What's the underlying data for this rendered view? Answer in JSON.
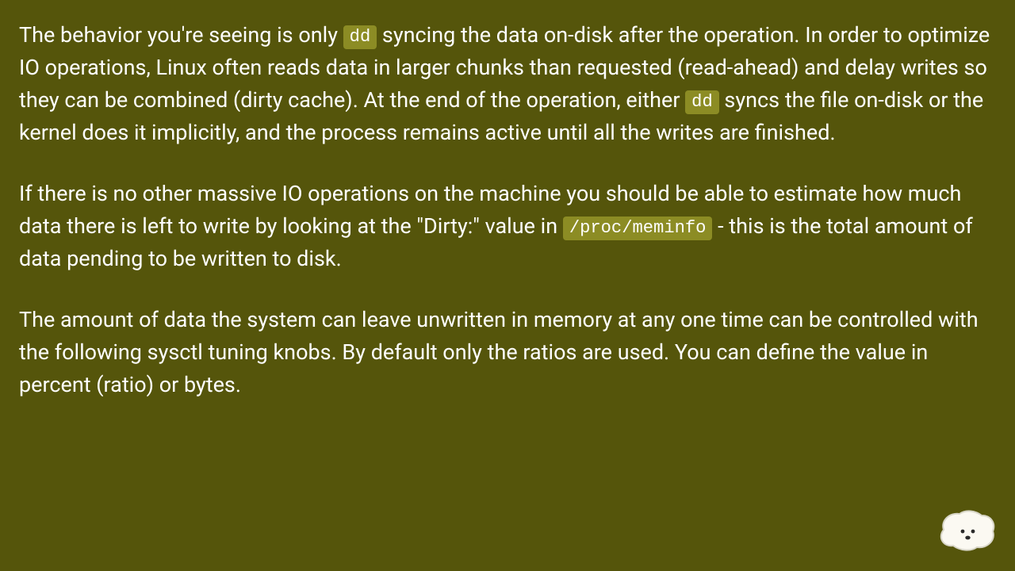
{
  "paragraphs": {
    "p1": {
      "seg1": "The behavior you're seeing is only ",
      "code1": "dd",
      "seg2": " syncing the data on-disk after the operation. In order to optimize IO operations, Linux often reads data in larger chunks than requested (read-ahead) and delay writes so they can be combined (dirty cache). At the end of the operation, either ",
      "code2": "dd",
      "seg3": " syncs the file on-disk or the kernel does it implicitly, and the process remains active until all the writes are finished."
    },
    "p2": {
      "seg1": "If there is no other massive IO operations on the machine you should be able to estimate how much data there is left to write by looking at the \"Dirty:\" value in ",
      "code1": "/proc/meminfo",
      "seg2": " - this is the total amount of data pending to be written to disk."
    },
    "p3": {
      "seg1": "The amount of data the system can leave unwritten in memory at any one time can be controlled with the following sysctl tuning knobs. By default only the ratios are used. You can define the value in percent (ratio) or bytes."
    }
  }
}
